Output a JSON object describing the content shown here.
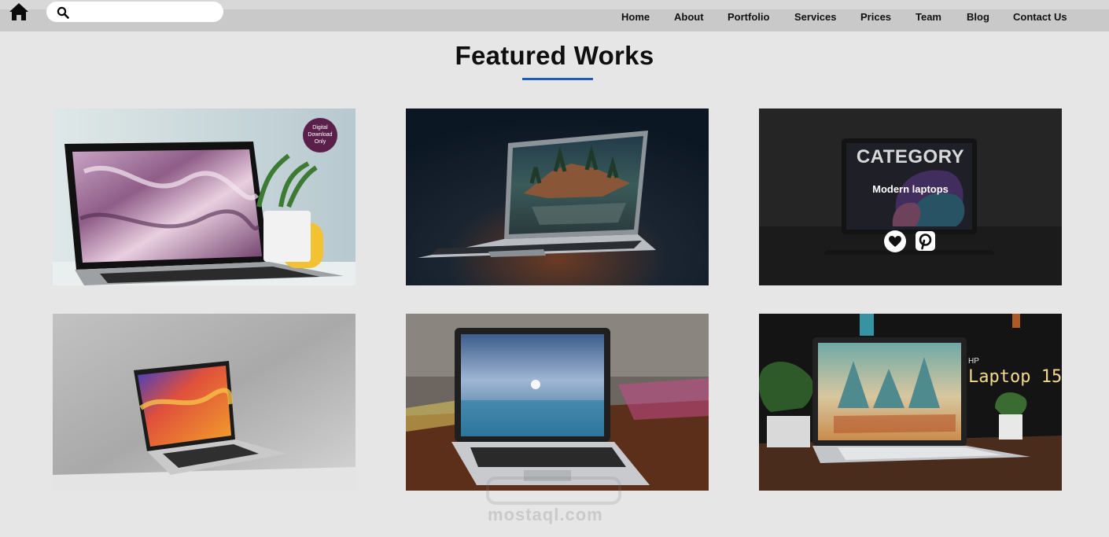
{
  "header": {
    "home_icon": "home-icon",
    "search": {
      "icon": "search-icon",
      "placeholder": "",
      "value": ""
    },
    "nav": [
      {
        "label": "Home"
      },
      {
        "label": "About"
      },
      {
        "label": "Portfolio"
      },
      {
        "label": "Services"
      },
      {
        "label": "Prices"
      },
      {
        "label": "Team"
      },
      {
        "label": "Blog"
      },
      {
        "label": "Contact Us"
      }
    ]
  },
  "section": {
    "title": "Featured Works",
    "accent_color": "#1e5bc6"
  },
  "works": [
    {
      "badge": "Digital Download Only"
    },
    {},
    {
      "overlay_title": "CATEGORY",
      "overlay_subtitle": "Modern laptops",
      "icons": [
        "heart-icon",
        "pinterest-icon"
      ]
    },
    {},
    {},
    {
      "brand": "HP",
      "model": "Laptop 15"
    }
  ],
  "watermark": "mostaql.com"
}
